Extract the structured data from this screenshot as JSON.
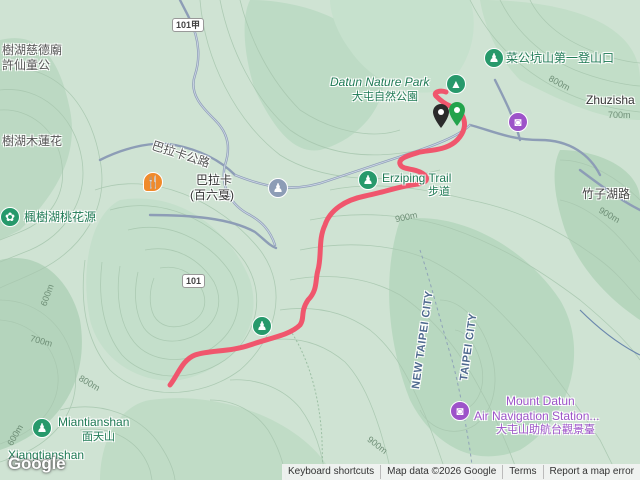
{
  "map": {
    "colors": {
      "terrain": "#cfe3d3",
      "forest": "#b6d7bf",
      "road": "#8d9db6",
      "route": "#f0566d",
      "park_green": "#27996b",
      "poi_purple": "#9d53c9",
      "restaurant_orange": "#f08a2b",
      "label_green": "#1f7a55",
      "boundary_blue": "#4f6a8f"
    },
    "labels": {
      "temple_line1": "樹湖慈德廟",
      "temple_line2": "許仙童公",
      "lotus": "樹湖木蓮花",
      "peach": "楓樹湖桃花源",
      "road_balaka": "巴拉卡公路",
      "balaka_name": "巴拉卡",
      "balaka_sub": "(百六戛)",
      "highway_101": "101",
      "highway_101a": "101甲",
      "datun_park_en": "Datun Nature Park",
      "datun_park_zh": "大屯自然公園",
      "caigong_trail": "菜公坑山第一登山口",
      "zhuzisha": "Zhuzisha",
      "zhuzi_lake_road": "竹子湖路",
      "erziping_en": "Erziping Trail",
      "erziping_zh": "步道",
      "new_taipei_1": "NEW TAIPEI CITY",
      "new_taipei_2": "TAIPEI CITY",
      "mount_datun_1": "Mount Datun",
      "mount_datun_2": "Air Navigation Station...",
      "mount_datun_zh": "大屯山助航台觀景臺",
      "miantianshan_en": "Miantianshan",
      "miantianshan_zh": "面天山",
      "xiangtianshan_en": "Xiangtianshan"
    },
    "contours": {
      "c1": "900m",
      "c2": "800m",
      "c3": "700m",
      "c4": "600m",
      "c5": "900m",
      "c6": "800m",
      "c7": "700m",
      "c8": "900m",
      "c9": "600m"
    },
    "icons": {
      "park": "tree-icon",
      "trailhead": "hiker-icon",
      "restaurant": "fork-knife-icon",
      "viewpoint": "camera-icon",
      "start_marker": "green-pin-icon",
      "end_marker": "black-pin-icon"
    },
    "route": {
      "description": "hiking track"
    },
    "footer": {
      "shortcuts": "Keyboard shortcuts",
      "map_data": "Map data ©2026 Google",
      "terms": "Terms",
      "report": "Report a map error"
    },
    "logo": "Google"
  }
}
